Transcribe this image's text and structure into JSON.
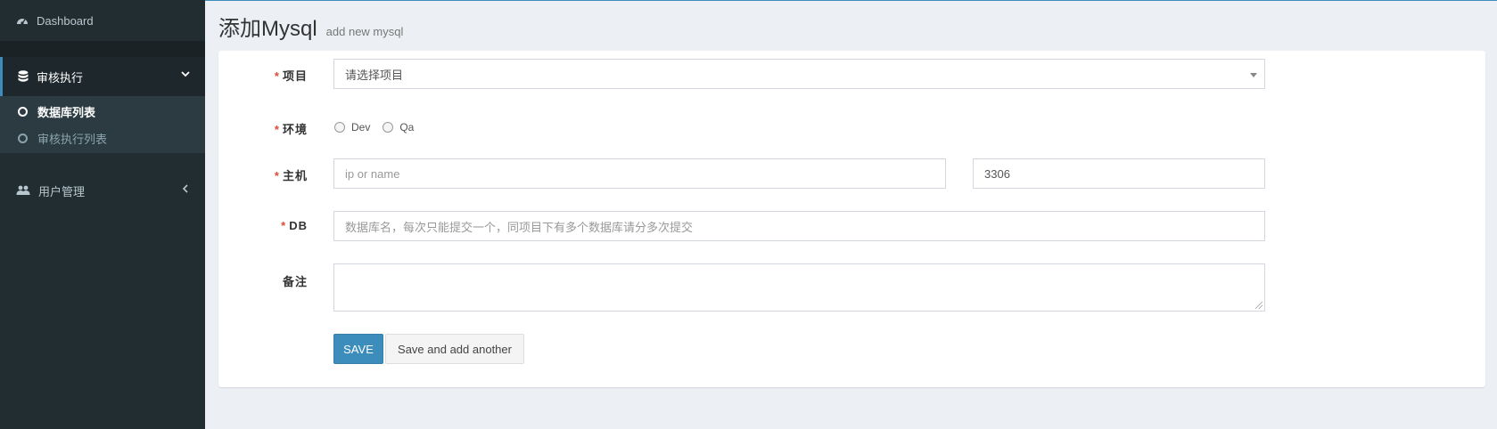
{
  "sidebar": {
    "dashboard": {
      "label": "Dashboard",
      "icon": "dashboard-icon"
    },
    "review": {
      "label": "审核执行",
      "icon": "database-icon",
      "expanded": true,
      "children": [
        {
          "label": "数据库列表",
          "active": true
        },
        {
          "label": "审核执行列表",
          "active": false
        }
      ]
    },
    "users": {
      "label": "用户管理",
      "icon": "users-icon"
    }
  },
  "header": {
    "title": "添加Mysql",
    "subtitle": "add new mysql"
  },
  "form": {
    "project": {
      "label": "项目",
      "required": true,
      "selected": "请选择项目"
    },
    "env": {
      "label": "环境",
      "required": true,
      "options": [
        "Dev",
        "Qa"
      ]
    },
    "host": {
      "label": "主机",
      "required": true,
      "placeholder": "ip or name",
      "port_value": "3306"
    },
    "db": {
      "label": "DB",
      "required": true,
      "placeholder": "数据库名，每次只能提交一个，同项目下有多个数据库请分多次提交"
    },
    "remark": {
      "label": "备注",
      "required": false,
      "value": ""
    },
    "required_mark": "*"
  },
  "buttons": {
    "save": "SAVE",
    "save_another": "Save and add another"
  },
  "colors": {
    "sidebar_bg": "#222d32",
    "accent": "#3c8dbc",
    "required": "#dd4b39",
    "page_bg": "#ecf0f5"
  }
}
